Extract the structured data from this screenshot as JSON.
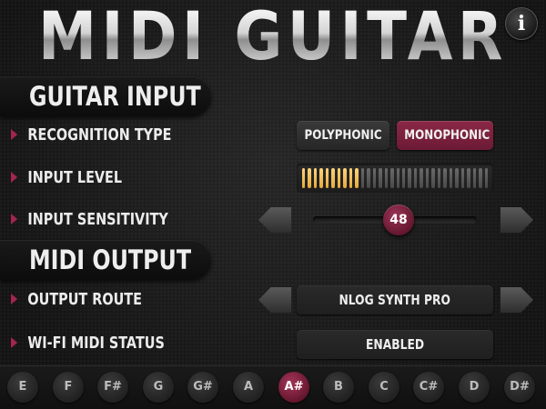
{
  "app": {
    "title": "MIDI GUITAR",
    "info_label": "i"
  },
  "guitar_input": {
    "title": "GUITAR INPUT",
    "recognition_type": {
      "label": "RECOGNITION TYPE",
      "options": [
        "POLYPHONIC",
        "MONOPHONIC"
      ],
      "selected": "MONOPHONIC"
    },
    "input_level": {
      "label": "INPUT LEVEL",
      "segments_total": 32,
      "segments_lit": 10
    },
    "input_sensitivity": {
      "label": "INPUT SENSITIVITY",
      "value": "48",
      "fraction": 0.5
    }
  },
  "midi_output": {
    "title": "MIDI OUTPUT",
    "output_route": {
      "label": "OUTPUT ROUTE",
      "value": "NLOG SYNTH PRO"
    },
    "wifi_status": {
      "label": "WI-FI MIDI STATUS",
      "value": "ENABLED"
    }
  },
  "notes": {
    "keys": [
      "E",
      "F",
      "F#",
      "G",
      "G#",
      "A",
      "A#",
      "B",
      "C",
      "C#",
      "D",
      "D#"
    ],
    "selected": "A#"
  },
  "colors": {
    "accent": "#8a2846",
    "level_on": "#f0be55",
    "level_off": "#5a5a5a"
  }
}
